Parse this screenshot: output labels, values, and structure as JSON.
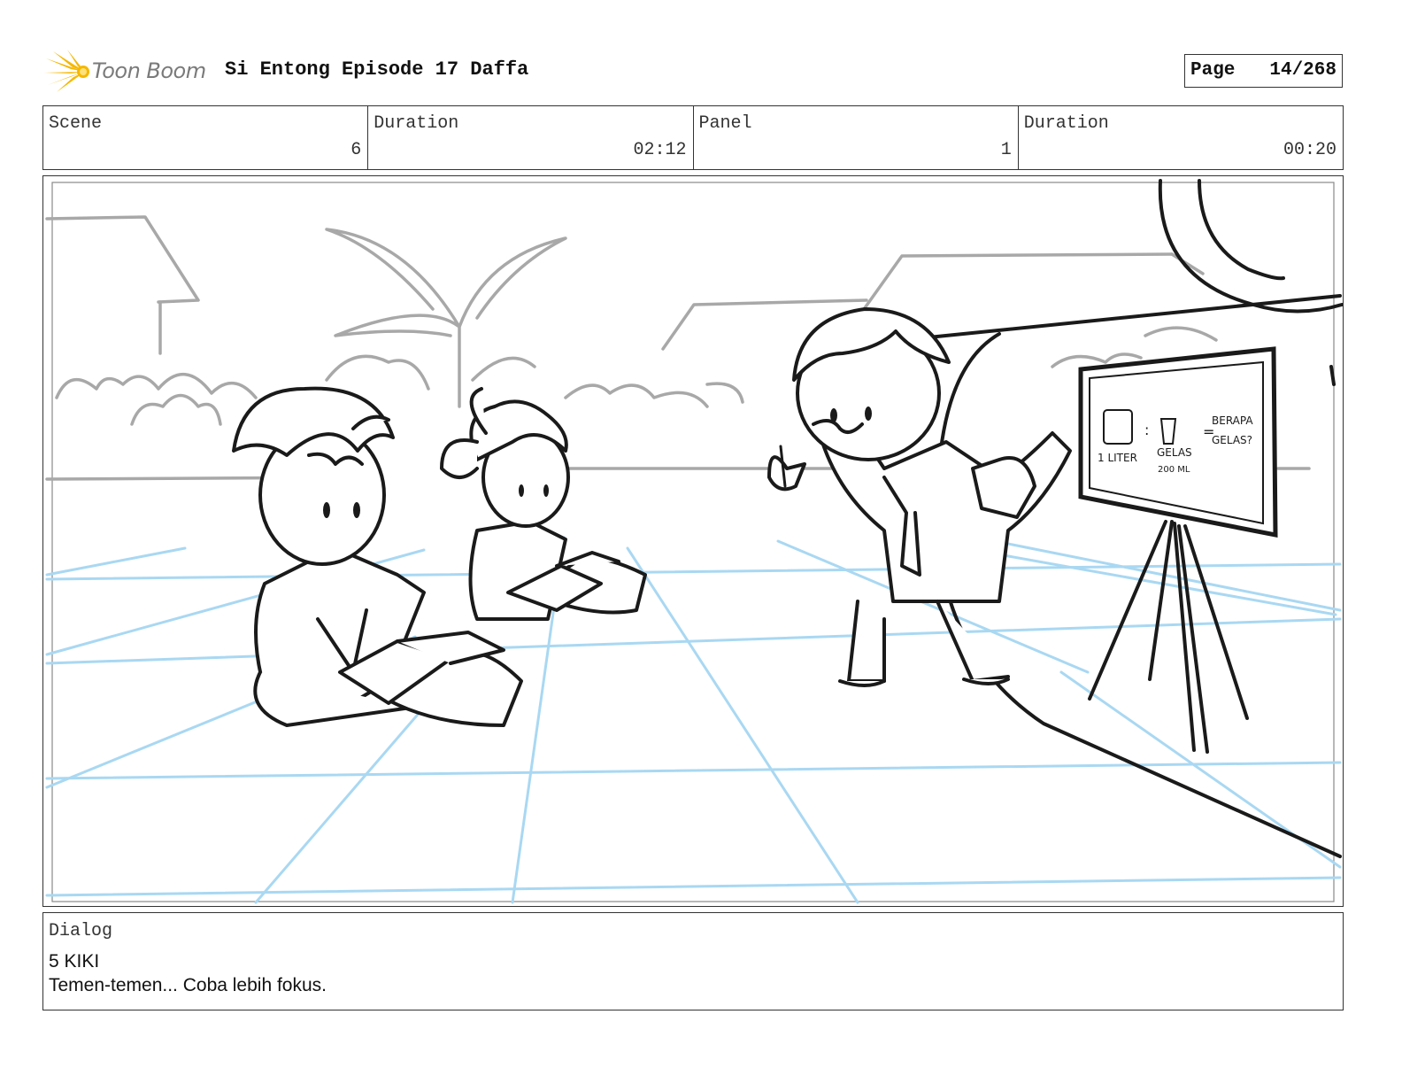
{
  "header": {
    "logo_text": "Toon Boom",
    "title": "Si Entong Episode 17 Daffa",
    "page_label": "Page",
    "page_number": "14/268"
  },
  "info": {
    "scene_label": "Scene",
    "scene_value": "6",
    "scene_duration_label": "Duration",
    "scene_duration_value": "02:12",
    "panel_label": "Panel",
    "panel_value": "1",
    "panel_duration_label": "Duration",
    "panel_duration_value": "00:20"
  },
  "board": {
    "line1": "1 LITER",
    "line2": "GELAS",
    "line3": "200 ML",
    "line4": "BERAPA",
    "line5": "GELAS?"
  },
  "dialog": {
    "label": "Dialog",
    "speaker": "5 KIKI",
    "text": "Temen-temen... Coba lebih fokus."
  },
  "colors": {
    "logo_flare": "#f5b800",
    "perspective_grid": "#a9d8f2",
    "background_sketch": "#a8a8a8",
    "ink": "#1a1a1a"
  }
}
